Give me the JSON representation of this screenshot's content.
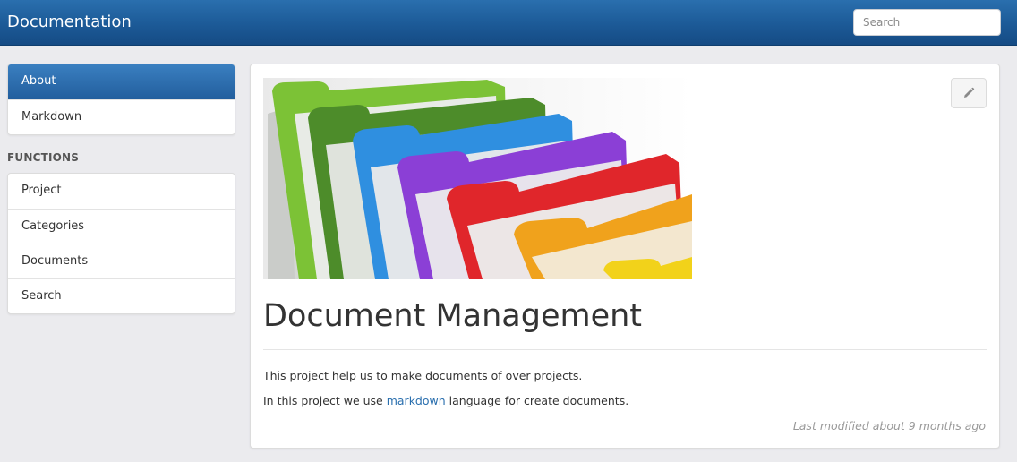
{
  "header": {
    "title": "Documentation",
    "search_placeholder": "Search"
  },
  "sidebar": {
    "primary_items": [
      {
        "label": "About",
        "active": true
      },
      {
        "label": "Markdown",
        "active": false
      }
    ],
    "functions_title": "FUNCTIONS",
    "function_items": [
      {
        "label": "Project"
      },
      {
        "label": "Categories"
      },
      {
        "label": "Documents"
      },
      {
        "label": "Search"
      }
    ]
  },
  "content": {
    "edit_icon": "pencil-icon",
    "banner_image": "colorful-file-folders",
    "title": "Document Management",
    "paragraph1": "This project help us to make documents of over projects.",
    "paragraph2_prefix": "In this project we use ",
    "paragraph2_link": "markdown",
    "paragraph2_suffix": " language for create documents.",
    "last_modified": "Last modified about 9 months ago"
  },
  "colors": {
    "header_bg": "#1c5a97",
    "active_item_bg": "#2a6fae",
    "link": "#2a6fae",
    "page_bg": "#ebebee"
  }
}
